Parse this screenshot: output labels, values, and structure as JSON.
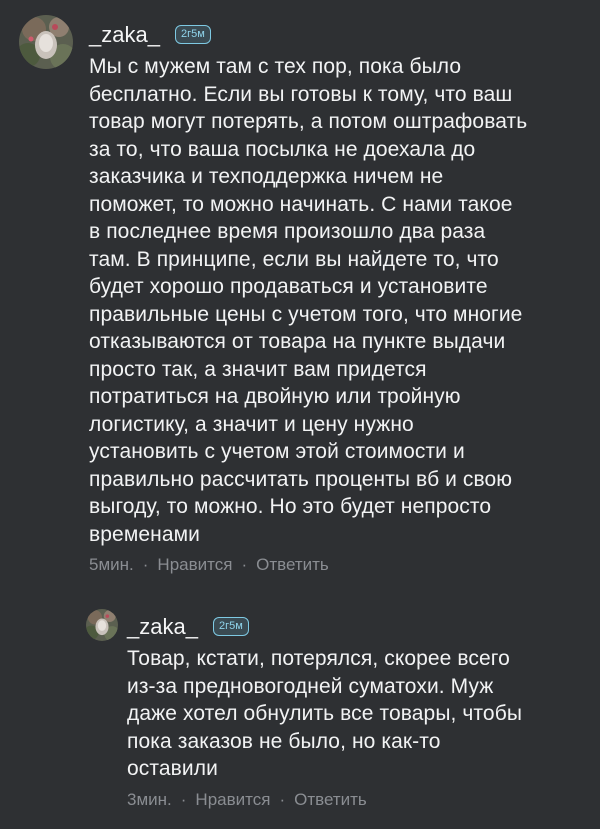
{
  "comments": [
    {
      "username": "_zaka_",
      "badge": "2г5м",
      "lines": [
        "Мы с мужем там с тех пор, пока было",
        "бесплатно. Если вы готовы к тому, что ваш",
        "товар могут потерять, а потом оштрафовать",
        "за то, что ваша посылка не доехала до",
        "заказчика и техподдержка ничем не",
        "поможет, то можно начинать. С нами такое",
        "в последнее время произошло два раза",
        "там. В принципе, если вы найдете то, что",
        "будет хорошо продаваться и установите",
        "правильные цены с учетом того, что многие",
        "отказываются от товара на пункте выдачи",
        "просто так, а значит вам придется",
        "потратиться на двойную или тройную",
        "логистику, а значит и цену нужно",
        "установить с учетом этой стоимости и",
        "правильно рассчитать проценты вб и свою",
        "выгоду, то можно. Но это будет непросто",
        "временами"
      ],
      "time": "5мин.",
      "like_label": "Нравится",
      "reply_label": "Ответить",
      "separator": "·"
    },
    {
      "username": "_zaka_",
      "badge": "2г5м",
      "lines": [
        "Товар, кстати, потерялся, скорее всего",
        "из-за предновогодней суматохи. Муж",
        "даже хотел обнулить все товары, чтобы",
        "пока заказов не было, но как-то",
        "оставили"
      ],
      "time": "3мин.",
      "like_label": "Нравится",
      "reply_label": "Ответить",
      "separator": "·"
    }
  ]
}
